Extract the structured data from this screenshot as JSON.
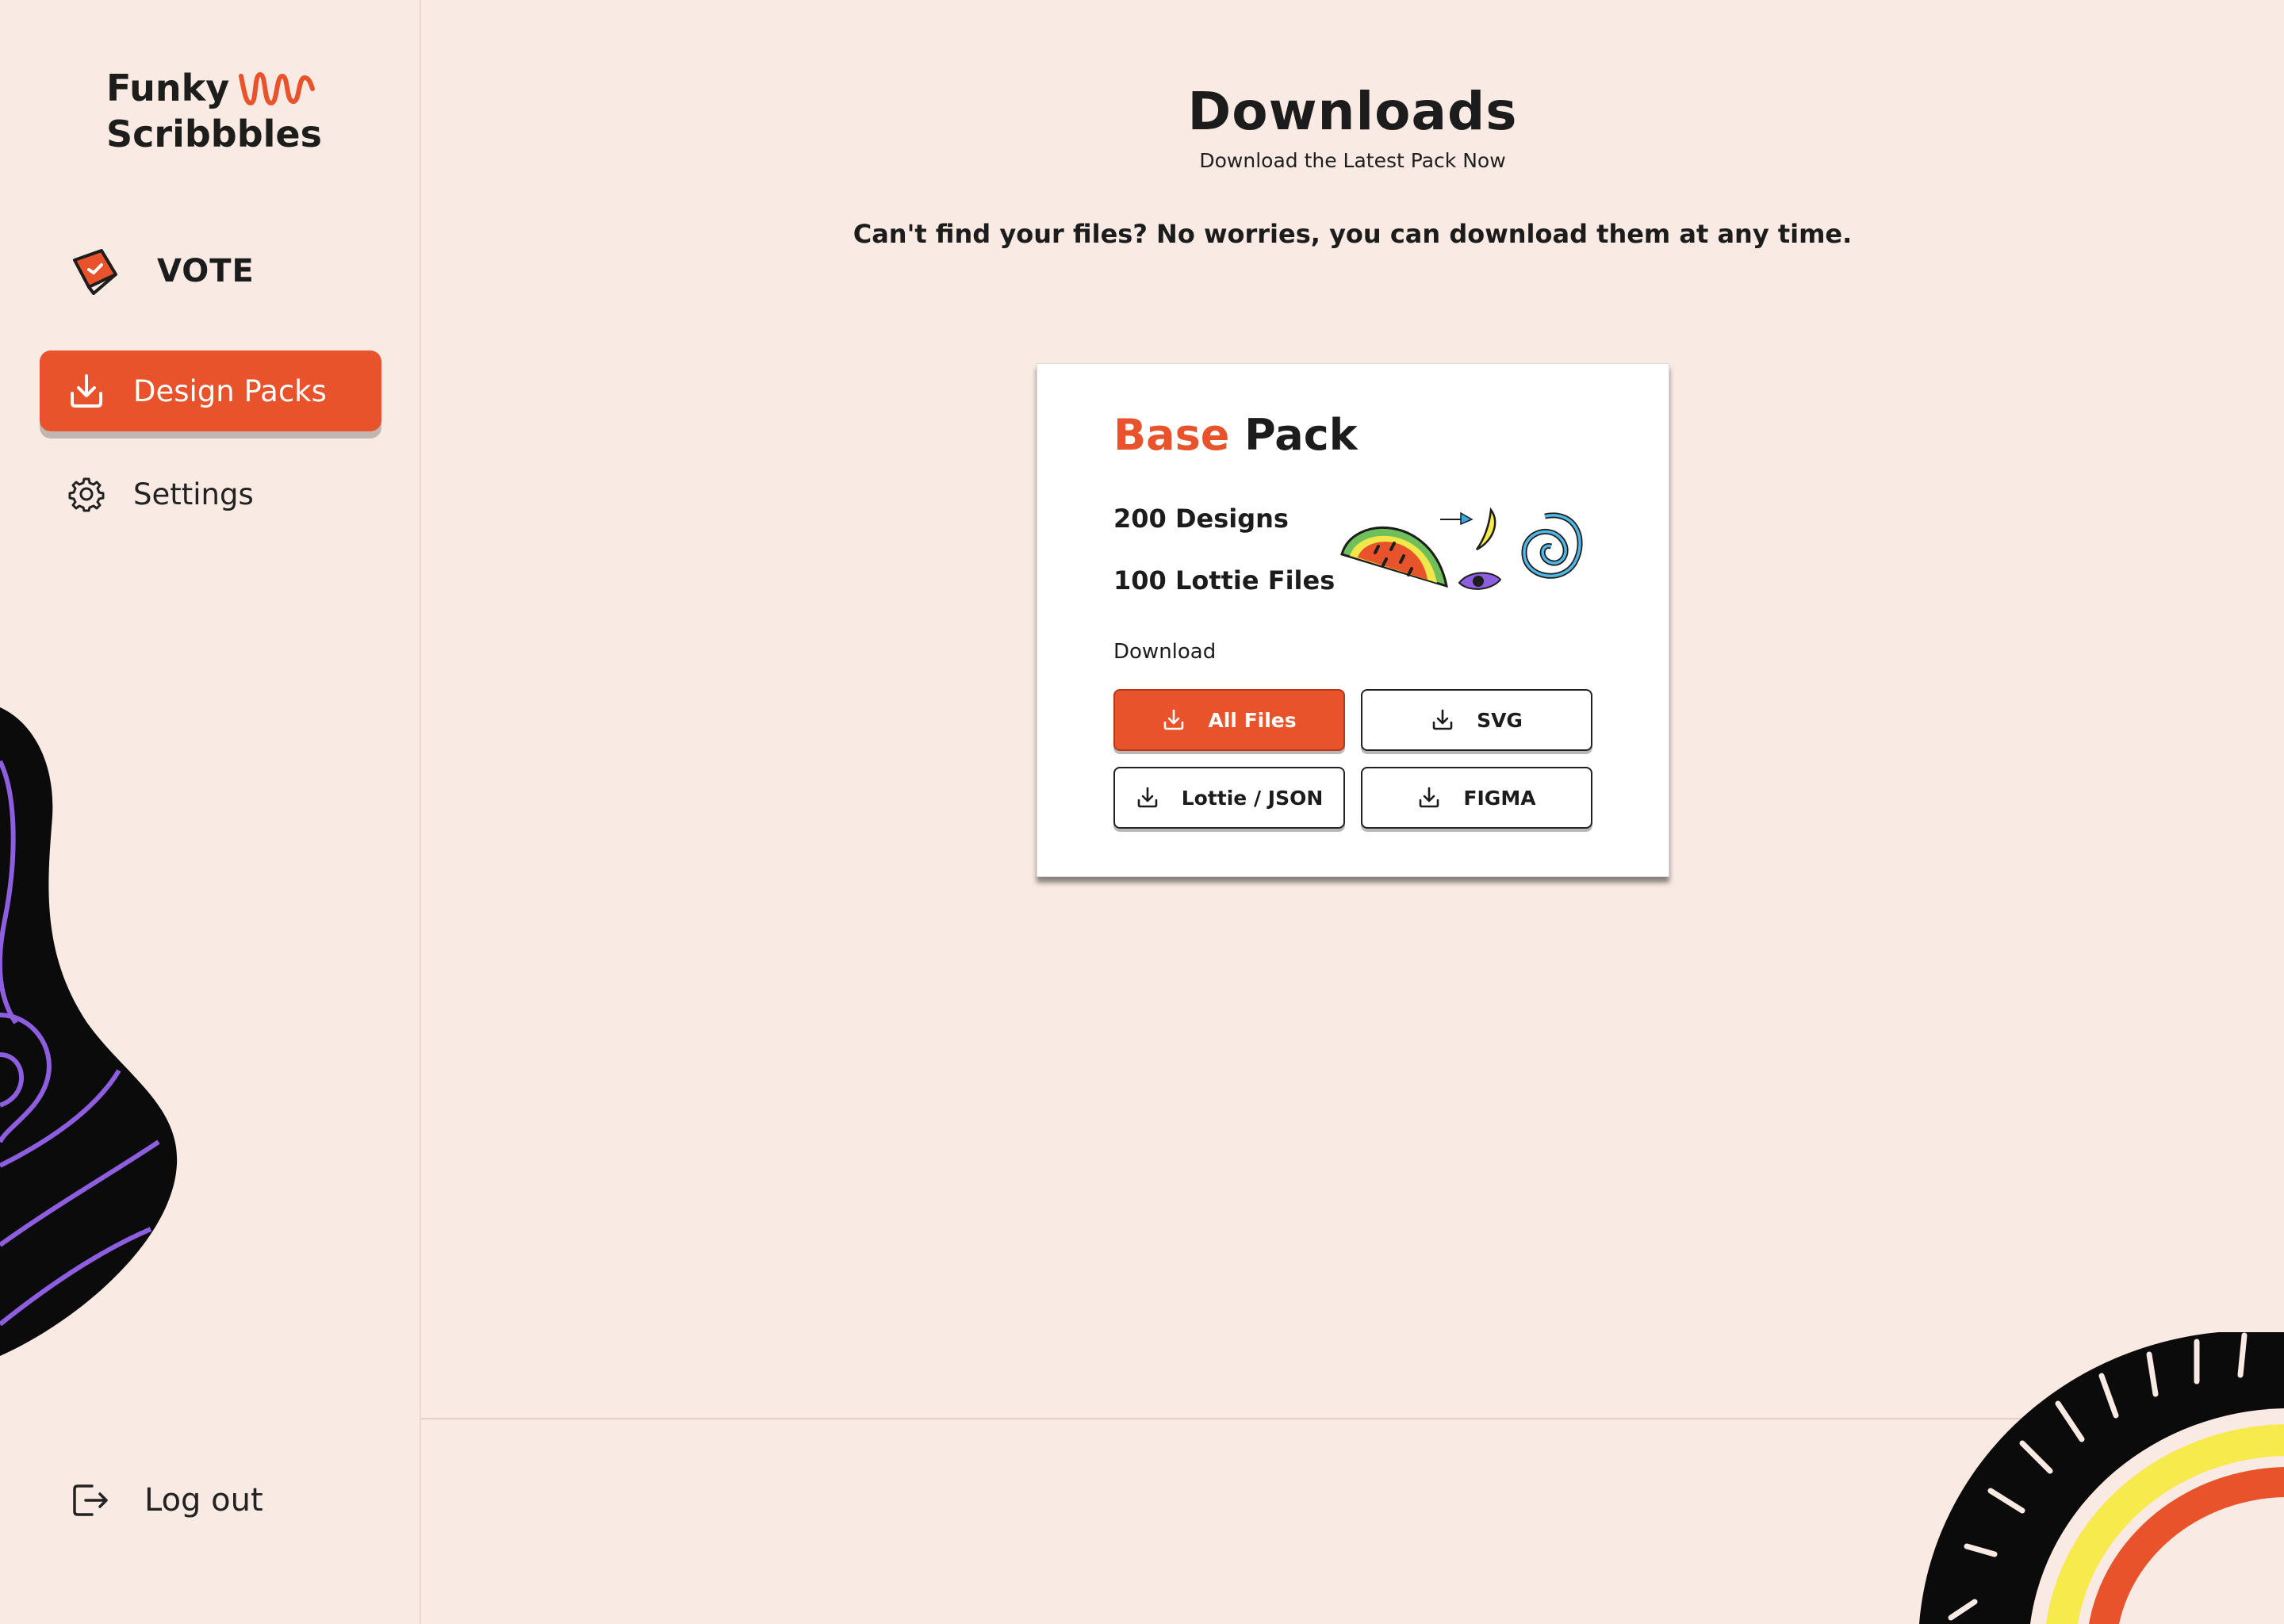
{
  "sidebar": {
    "logo_line1": "Funky",
    "logo_line2": "Scribbbles",
    "vote_label": "VOTE",
    "items": [
      {
        "label": "Design Packs",
        "icon": "download-icon",
        "active": true
      },
      {
        "label": "Settings",
        "icon": "gear-icon",
        "active": false
      }
    ],
    "logout_label": "Log out"
  },
  "header": {
    "title": "Downloads",
    "subtitle": "Download the Latest Pack Now",
    "note": "Can't find your files? No worries, you can download them at any time."
  },
  "card": {
    "title_accent": "Base",
    "title_rest": " Pack",
    "stats": [
      "200 Designs",
      "100 Lottie Files"
    ],
    "download_label": "Download",
    "buttons": [
      "All Files",
      "SVG",
      "Lottie  / JSON",
      "FIGMA"
    ]
  },
  "colors": {
    "background": "#f9eae3",
    "accent": "#e8532c",
    "blob_line": "#8e5ee0",
    "rainbow_yellow": "#f6ea4c"
  }
}
